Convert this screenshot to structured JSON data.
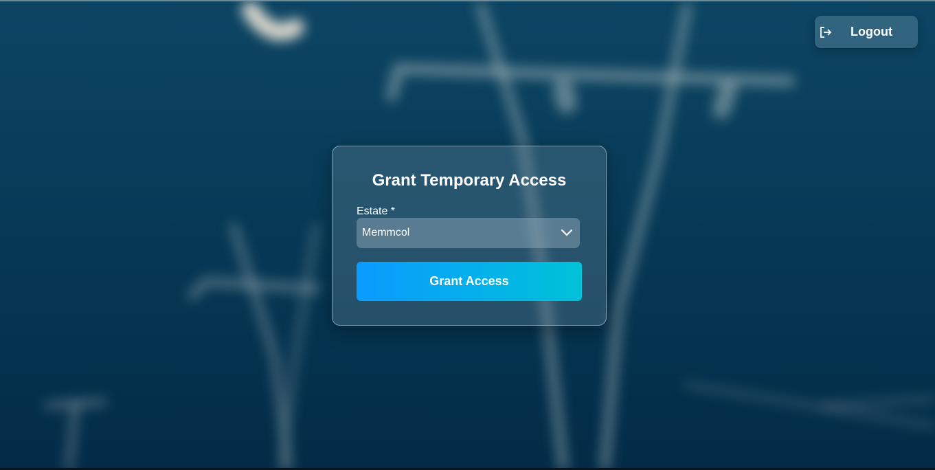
{
  "header": {
    "logout_label": "Logout",
    "logout_icon": "logout-icon"
  },
  "form": {
    "title": "Grant Temporary Access",
    "estate_label": "Estate *",
    "estate_selected": "Memmcol",
    "estate_icon": "chevron-down-icon",
    "submit_label": "Grant Access"
  },
  "colors": {
    "background": "#073a57",
    "button_start": "#0a9bff",
    "button_end": "#00c2d8",
    "text": "#ffffff"
  }
}
